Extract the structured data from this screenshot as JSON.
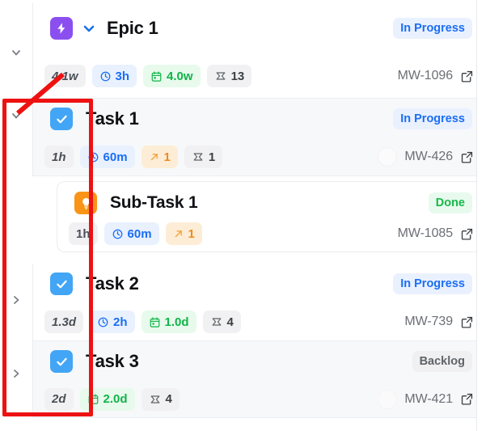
{
  "rows": [
    {
      "id": "epic-1",
      "type": "epic",
      "type_icon": "lightning-bolt-icon",
      "title": "Epic 1",
      "expanded": true,
      "twisty_icon": "chevron-down-icon",
      "status": {
        "label": "In Progress",
        "variant": "inprogress",
        "color": "#1a6ef5"
      },
      "chips": [
        {
          "kind": "est",
          "icon": null,
          "label": "4.1w"
        },
        {
          "kind": "time",
          "icon": "clock-icon",
          "label": "3h"
        },
        {
          "kind": "date",
          "icon": "calendar-icon",
          "label": "4.0w"
        },
        {
          "kind": "pts",
          "icon": "points-icon",
          "label": "13"
        }
      ],
      "avatar": false,
      "key": "MW-1096",
      "link_icon": "external-link-icon"
    },
    {
      "id": "task-1",
      "type": "task",
      "type_icon": "check-square-icon",
      "title": "Task 1",
      "expanded": true,
      "twisty_icon": "chevron-down-icon",
      "status": {
        "label": "In Progress",
        "variant": "inprogress",
        "color": "#1a6ef5"
      },
      "chips": [
        {
          "kind": "est",
          "icon": null,
          "label": "1h"
        },
        {
          "kind": "time",
          "icon": "clock-icon",
          "label": "60m"
        },
        {
          "kind": "up",
          "icon": "arrow-up-right-icon",
          "label": "1"
        },
        {
          "kind": "pts",
          "icon": "points-icon",
          "label": "1"
        }
      ],
      "avatar": true,
      "key": "MW-426",
      "link_icon": "external-link-icon"
    },
    {
      "id": "sub-task-1",
      "type": "subtask",
      "type_icon": "lightbulb-icon",
      "title": "Sub-Task 1",
      "expanded": null,
      "twisty_icon": null,
      "status": {
        "label": "Done",
        "variant": "done",
        "color": "#18b84a"
      },
      "chips": [
        {
          "kind": "est",
          "icon": null,
          "label": "1h"
        },
        {
          "kind": "time",
          "icon": "clock-icon",
          "label": "60m"
        },
        {
          "kind": "up",
          "icon": "arrow-up-right-icon",
          "label": "1"
        }
      ],
      "avatar": false,
      "key": "MW-1085",
      "link_icon": "external-link-icon"
    },
    {
      "id": "task-2",
      "type": "task",
      "type_icon": "check-square-icon",
      "title": "Task 2",
      "expanded": false,
      "twisty_icon": "chevron-right-icon",
      "status": {
        "label": "In Progress",
        "variant": "inprogress",
        "color": "#1a6ef5"
      },
      "chips": [
        {
          "kind": "est",
          "icon": null,
          "label": "1.3d"
        },
        {
          "kind": "time",
          "icon": "clock-icon",
          "label": "2h"
        },
        {
          "kind": "date",
          "icon": "calendar-icon",
          "label": "1.0d"
        },
        {
          "kind": "pts",
          "icon": "points-icon",
          "label": "4"
        }
      ],
      "avatar": false,
      "key": "MW-739",
      "link_icon": "external-link-icon"
    },
    {
      "id": "task-3",
      "type": "task",
      "type_icon": "check-square-icon",
      "title": "Task 3",
      "expanded": false,
      "twisty_icon": "chevron-right-icon",
      "status": {
        "label": "Backlog",
        "variant": "backlog",
        "color": "#5f6368"
      },
      "chips": [
        {
          "kind": "est",
          "icon": null,
          "label": "2d"
        },
        {
          "kind": "date",
          "icon": "calendar-icon",
          "label": "2.0d"
        },
        {
          "kind": "pts",
          "icon": "points-icon",
          "label": "4"
        }
      ],
      "avatar": true,
      "key": "MW-421",
      "link_icon": "external-link-icon"
    }
  ],
  "annotation": {
    "shape": "rectangle-with-leader-line",
    "color": "#ee1111"
  }
}
